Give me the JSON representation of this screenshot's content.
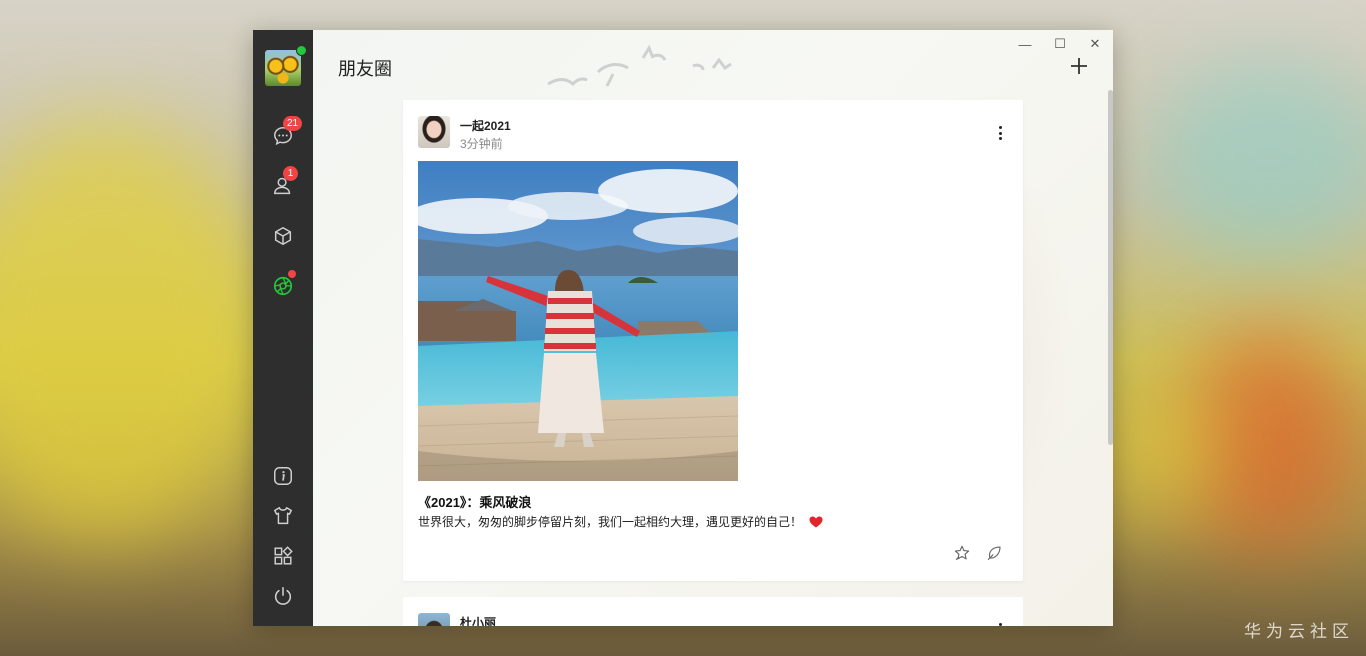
{
  "watermark": "华为云社区",
  "sidebar": {
    "items": [
      {
        "name": "chat",
        "icon": "chat-bubble-icon",
        "badge": "21"
      },
      {
        "name": "contacts",
        "icon": "contacts-icon",
        "badge": "1"
      },
      {
        "name": "box",
        "icon": "cube-icon",
        "badge": ""
      },
      {
        "name": "moments",
        "icon": "aperture-icon",
        "badge": "dot"
      }
    ],
    "bottom_items": [
      {
        "name": "info",
        "icon": "info-icon"
      },
      {
        "name": "skin",
        "icon": "tshirt-icon"
      },
      {
        "name": "apps",
        "icon": "apps-grid-icon"
      },
      {
        "name": "power",
        "icon": "power-icon"
      }
    ],
    "accent_color": "#22c93a"
  },
  "header": {
    "title": "朋友圈"
  },
  "window_controls": {
    "minimize": "—",
    "maximize": "☐",
    "close": "✕"
  },
  "posts": [
    {
      "author": "一起2021",
      "time": "3分钟前",
      "title": "《2021》：乘风破浪",
      "text": "世界很大，匆匆的脚步停留片刻，我们一起相约大理，遇见更好的自己！"
    },
    {
      "author": "杜小丽",
      "time": "",
      "title": "",
      "text": ""
    }
  ]
}
